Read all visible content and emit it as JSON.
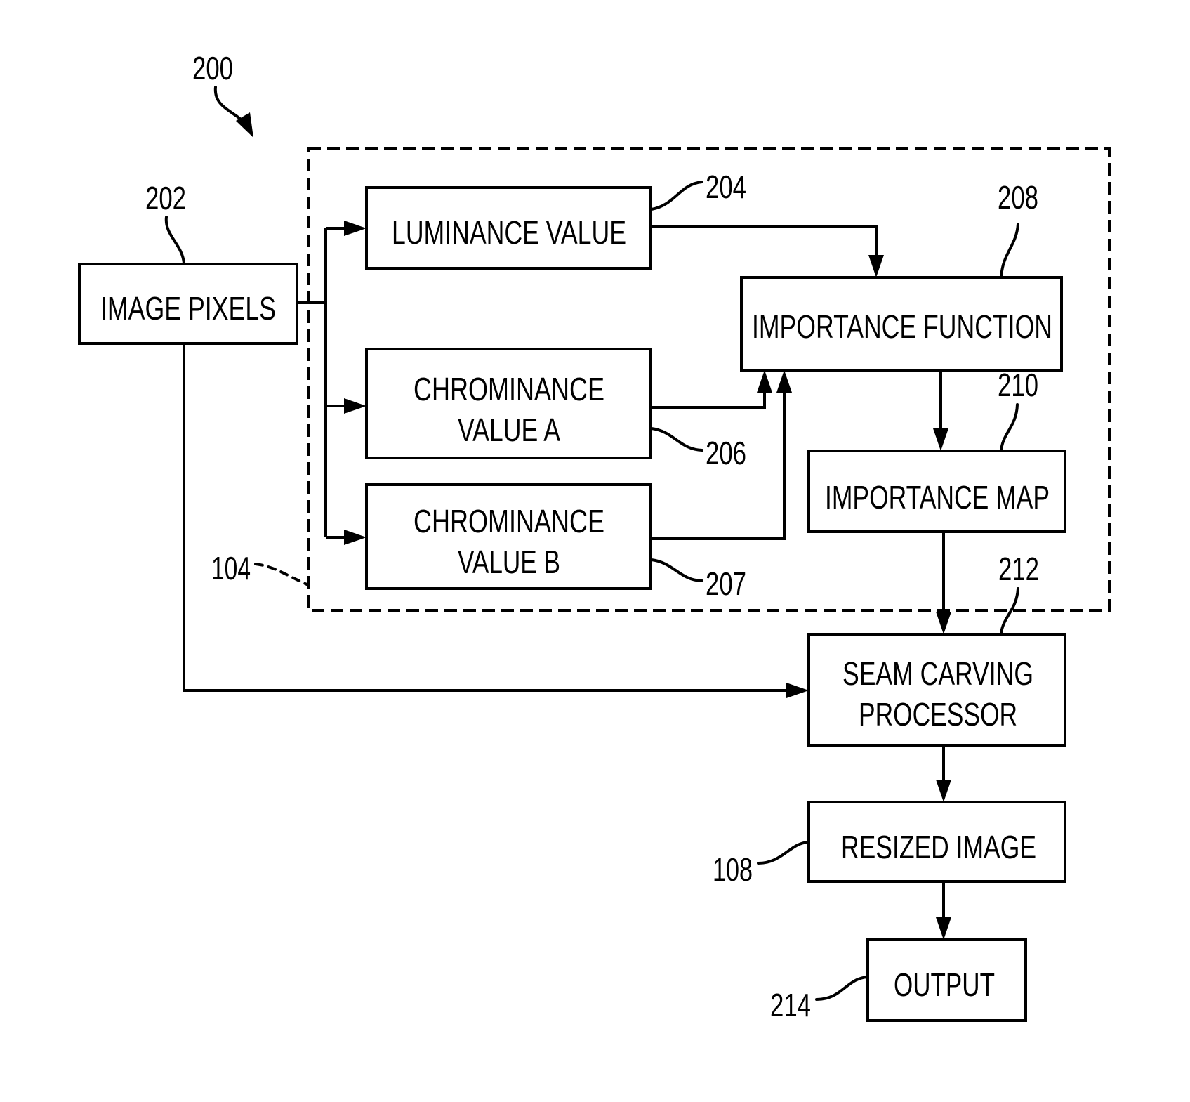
{
  "figure": {
    "ref": "200"
  },
  "group": {
    "ref": "104"
  },
  "blocks": {
    "image_pixels": {
      "lines": [
        "IMAGE PIXELS"
      ],
      "ref": "202"
    },
    "luminance": {
      "lines": [
        "LUMINANCE VALUE"
      ],
      "ref": "204"
    },
    "chrominance_a": {
      "lines": [
        "CHROMINANCE",
        "VALUE A"
      ],
      "ref": "206"
    },
    "chrominance_b": {
      "lines": [
        "CHROMINANCE",
        "VALUE B"
      ],
      "ref": "207"
    },
    "importance_function": {
      "lines": [
        "IMPORTANCE FUNCTION"
      ],
      "ref": "208"
    },
    "importance_map": {
      "lines": [
        "IMPORTANCE MAP"
      ],
      "ref": "210"
    },
    "seam_carving": {
      "lines": [
        "SEAM CARVING",
        "PROCESSOR"
      ],
      "ref": "212"
    },
    "resized_image": {
      "lines": [
        "RESIZED IMAGE"
      ],
      "ref": "108"
    },
    "output": {
      "lines": [
        "OUTPUT"
      ],
      "ref": "214"
    }
  },
  "colors": {
    "ink": "#000000",
    "background": "#ffffff"
  }
}
